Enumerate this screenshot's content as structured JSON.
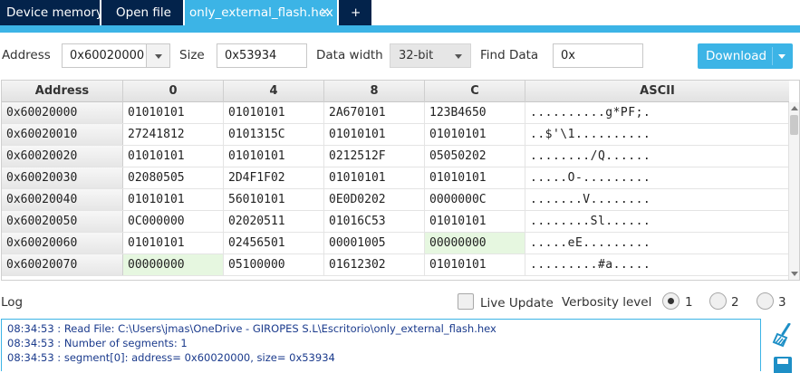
{
  "tabs": [
    {
      "label": "Device memory"
    },
    {
      "label": "Open file"
    },
    {
      "label": "only_external_flash.hex",
      "close": "×"
    },
    {
      "label": "+"
    }
  ],
  "toolbar": {
    "address_label": "Address",
    "address_value": "0x60020000",
    "size_label": "Size",
    "size_value": "0x53934",
    "data_width_label": "Data width",
    "data_width_value": "32-bit",
    "find_label": "Find Data",
    "find_value": "0x",
    "download_label": "Download"
  },
  "table": {
    "headers": [
      "Address",
      "0",
      "4",
      "8",
      "C",
      "ASCII"
    ],
    "rows": [
      {
        "addr": "0x60020000",
        "c0": "01010101",
        "c4": "01010101",
        "c8": "2A670101",
        "cc": "123B4650",
        "ascii": "..........g*PF;."
      },
      {
        "addr": "0x60020010",
        "c0": "27241812",
        "c4": "0101315C",
        "c8": "01010101",
        "cc": "01010101",
        "ascii": "..$'\\1.........."
      },
      {
        "addr": "0x60020020",
        "c0": "01010101",
        "c4": "01010101",
        "c8": "0212512F",
        "cc": "05050202",
        "ascii": "......../Q......"
      },
      {
        "addr": "0x60020030",
        "c0": "02080505",
        "c4": "2D4F1F02",
        "c8": "01010101",
        "cc": "01010101",
        "ascii": ".....O-........."
      },
      {
        "addr": "0x60020040",
        "c0": "01010101",
        "c4": "56010101",
        "c8": "0E0D0202",
        "cc": "0000000C",
        "ascii": ".......V........"
      },
      {
        "addr": "0x60020050",
        "c0": "0C000000",
        "c4": "02020511",
        "c8": "01016C53",
        "cc": "01010101",
        "ascii": "........Sl......"
      },
      {
        "addr": "0x60020060",
        "c0": "01010101",
        "c4": "02456501",
        "c8": "00001005",
        "cc": "00000000",
        "ascii": ".....eE........."
      },
      {
        "addr": "0x60020070",
        "c0": "00000000",
        "c4": "05100000",
        "c8": "01612302",
        "cc": "01010101",
        "ascii": ".........#a....."
      }
    ]
  },
  "log": {
    "label": "Log",
    "live_update_label": "Live Update",
    "verbosity_label": "Verbosity level",
    "verbosity_options": [
      "1",
      "2",
      "3"
    ],
    "verbosity_selected": "1",
    "lines": [
      "08:34:53 : Read File: C:\\Users\\jmas\\OneDrive - GIROPES S.L\\Escritorio\\only_external_flash.hex",
      "08:34:53 : Number of segments: 1",
      "08:34:53 : segment[0]: address= 0x60020000, size= 0x53934"
    ]
  },
  "colors": {
    "tab_dark": "#03234b",
    "tab_active": "#3cb4e6",
    "highlight_cell": "#e6f7e0",
    "log_text": "#1a3a8c"
  },
  "icons": [
    "close-icon",
    "chevron-down-icon",
    "broom-icon",
    "save-icon"
  ]
}
